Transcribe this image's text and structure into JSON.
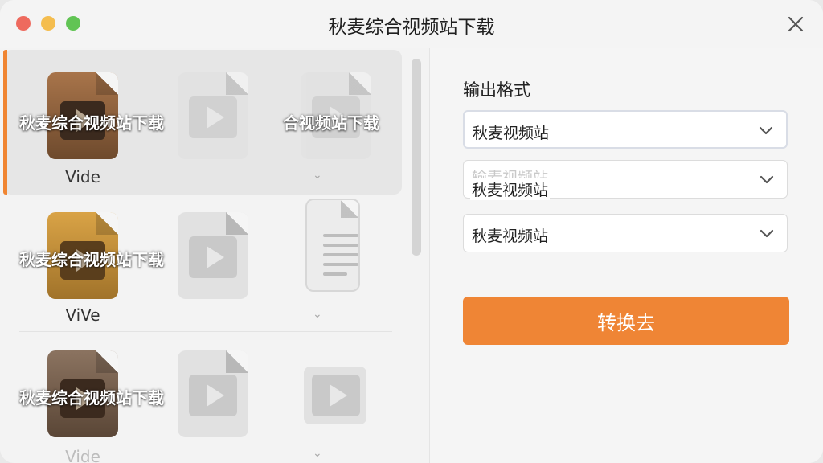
{
  "window": {
    "title": "秋麦综合视频站下载"
  },
  "left_panel": {
    "rows": [
      {
        "overlay_left": "秋麦综合视频站下载",
        "overlay_right": "合视频站下载",
        "name": "Vide"
      },
      {
        "overlay_left": "秋麦综合视频站下载",
        "name": "ViVe"
      },
      {
        "overlay_left": "秋麦综合视频站下载",
        "name": "Vide"
      }
    ]
  },
  "right_panel": {
    "output_label": "输出格式",
    "select1": {
      "value": "秋麦视频站"
    },
    "select2": {
      "placeholder": "输麦视频站",
      "value": "秋麦视频站"
    },
    "select3": {
      "value": "秋麦视频站"
    },
    "convert_label": "转换去"
  },
  "colors": {
    "accent": "#ef8535",
    "selection_bar": "#f08532",
    "traffic_red": "#ee6a5e",
    "traffic_yellow": "#f4bd4f",
    "traffic_green": "#61c454"
  }
}
